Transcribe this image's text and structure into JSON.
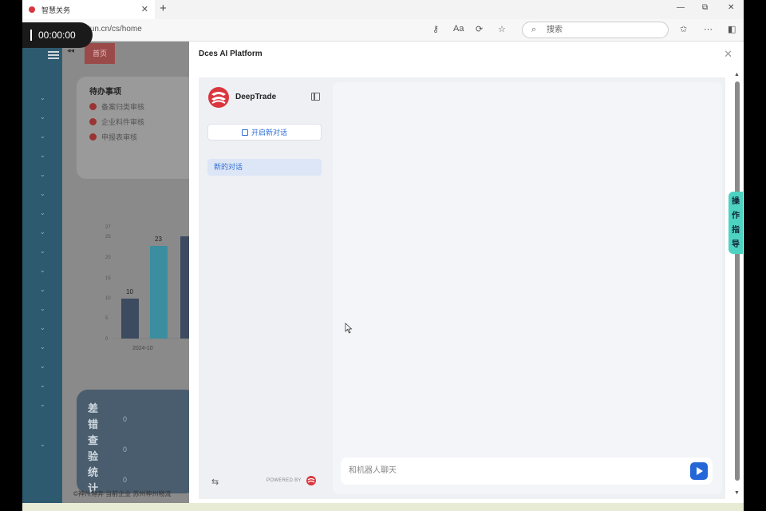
{
  "browser": {
    "tab_title": "智慧关务",
    "new_tab": "+",
    "url": "tun.cn/cs/home",
    "search_placeholder": "搜索",
    "recording_time": "00:00:00"
  },
  "background_app": {
    "home_tab": "首页",
    "todo_title": "待办事项",
    "todo_items": [
      "备案归类审核",
      "企业料件审核",
      "申报表审核"
    ],
    "chart_ticks": [
      "27",
      "25",
      "20",
      "15",
      "10",
      "5",
      "0"
    ],
    "chart_bar_labels": [
      "10",
      "23"
    ],
    "chart_x_label": "2024-10",
    "stat_title": "差错查验统计",
    "stat_values": [
      "0",
      "0",
      "0"
    ],
    "footer": "©神州博奔 当前企业 苏州神州物流"
  },
  "modal": {
    "title": "Dces AI Platform",
    "brand": "DeepTrade",
    "new_chat": "开启新对话",
    "conversation": "新的对话",
    "powered_by": "POWERED BY",
    "input_placeholder": "和机器人聊天"
  },
  "guide_tab": [
    "操",
    "作",
    "指",
    "导"
  ],
  "colors": {
    "accent": "#2667d8",
    "brand_red": "#d9363e",
    "guide": "#4cd3c2"
  }
}
